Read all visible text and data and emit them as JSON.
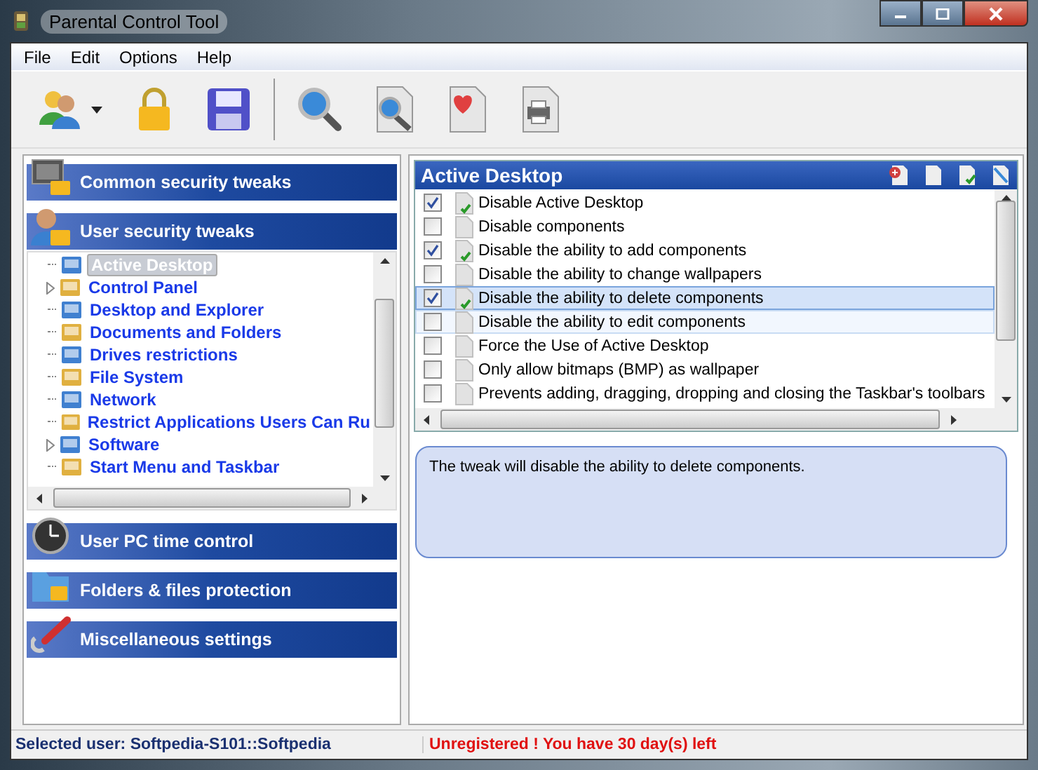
{
  "window": {
    "title": "Parental Control Tool"
  },
  "menu": [
    "File",
    "Edit",
    "Options",
    "Help"
  ],
  "sections": [
    {
      "label": "Common security tweaks",
      "kind": "monitor"
    },
    {
      "label": "User security tweaks",
      "kind": "user",
      "tree": [
        {
          "label": "Active Desktop",
          "selected": true,
          "expandable": false
        },
        {
          "label": "Control Panel",
          "selected": false,
          "expandable": true
        },
        {
          "label": "Desktop and Explorer",
          "selected": false,
          "expandable": false
        },
        {
          "label": "Documents and Folders",
          "selected": false,
          "expandable": false
        },
        {
          "label": "Drives restrictions",
          "selected": false,
          "expandable": false
        },
        {
          "label": "File System",
          "selected": false,
          "expandable": false
        },
        {
          "label": "Network",
          "selected": false,
          "expandable": false
        },
        {
          "label": "Restrict Applications Users Can Ru",
          "selected": false,
          "expandable": false
        },
        {
          "label": "Software",
          "selected": false,
          "expandable": true
        },
        {
          "label": "Start Menu and Taskbar",
          "selected": false,
          "expandable": false
        }
      ]
    },
    {
      "label": "User PC time control",
      "kind": "clock"
    },
    {
      "label": "Folders & files protection",
      "kind": "folder"
    },
    {
      "label": "Miscellaneous settings",
      "kind": "tools"
    }
  ],
  "panel": {
    "title": "Active Desktop",
    "tweaks": [
      {
        "label": "Disable Active Desktop",
        "checked": true,
        "selected": false,
        "hovered": false
      },
      {
        "label": "Disable components",
        "checked": false,
        "selected": false,
        "hovered": false
      },
      {
        "label": "Disable the ability to add components",
        "checked": true,
        "selected": false,
        "hovered": false
      },
      {
        "label": "Disable the ability to change wallpapers",
        "checked": false,
        "selected": false,
        "hovered": false
      },
      {
        "label": "Disable the ability to delete components",
        "checked": true,
        "selected": true,
        "hovered": false
      },
      {
        "label": "Disable the ability to edit components",
        "checked": false,
        "selected": false,
        "hovered": true
      },
      {
        "label": "Force the Use of Active Desktop",
        "checked": false,
        "selected": false,
        "hovered": false
      },
      {
        "label": "Only allow bitmaps (BMP) as wallpaper",
        "checked": false,
        "selected": false,
        "hovered": false
      },
      {
        "label": "Prevents adding, dragging, dropping and closing the Taskbar's toolbars",
        "checked": false,
        "selected": false,
        "hovered": false
      }
    ],
    "description": "The tweak will disable the ability to delete components."
  },
  "status_bar": {
    "user": "Selected user: Softpedia-S101::Softpedia",
    "registration": "Unregistered ! You have 30 day(s) left"
  }
}
